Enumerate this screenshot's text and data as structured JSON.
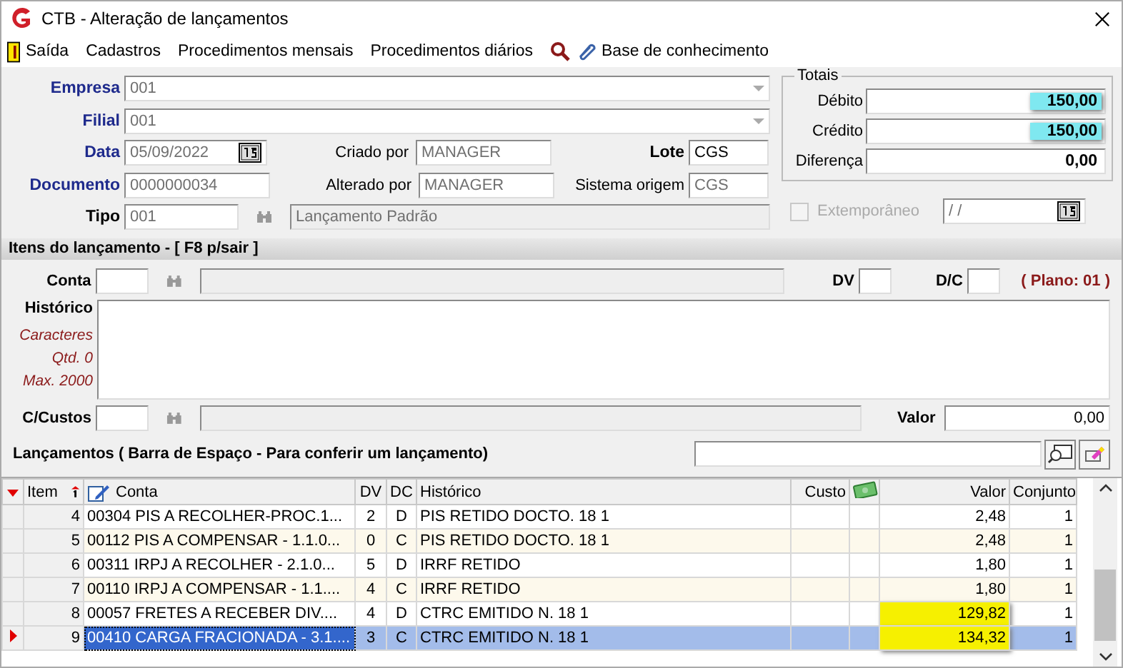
{
  "window": {
    "title": "CTB - Alteração de lançamentos"
  },
  "menu": [
    {
      "label": "Saída",
      "kind": "exit"
    },
    {
      "label": "Cadastros",
      "kind": "text"
    },
    {
      "label": "Procedimentos mensais",
      "kind": "text"
    },
    {
      "label": "Procedimentos diários",
      "kind": "text"
    },
    {
      "kind": "search"
    },
    {
      "label": "Base de conhecimento",
      "kind": "link"
    }
  ],
  "header": {
    "empresa": {
      "label": "Empresa",
      "value": "001"
    },
    "filial": {
      "label": "Filial",
      "value": "001"
    },
    "data": {
      "label": "Data",
      "value": "05/09/2022"
    },
    "documento": {
      "label": "Documento",
      "value": "0000000034"
    },
    "tipo": {
      "label": "Tipo",
      "value": "001",
      "description": "Lançamento Padrão"
    },
    "criado_por": {
      "label": "Criado por",
      "value": "MANAGER"
    },
    "alterado_por": {
      "label": "Alterado por",
      "value": "MANAGER"
    },
    "lote": {
      "label": "Lote",
      "value": "CGS"
    },
    "sistema_origem": {
      "label": "Sistema origem",
      "value": "CGS"
    }
  },
  "totais": {
    "title": "Totais",
    "rows": [
      {
        "label": "Débito",
        "value": "150,00",
        "highlighted": true
      },
      {
        "label": "Crédito",
        "value": "150,00",
        "highlighted": true
      },
      {
        "label": "Diferença",
        "value": "0,00",
        "highlighted": false
      }
    ]
  },
  "extemporaneo": {
    "label": "Extemporâneo",
    "checked": false,
    "disabled": true,
    "date": "/ /"
  },
  "itens": {
    "title": "Itens do lançamento - [ F8 p/sair ]",
    "conta_label": "Conta",
    "dv_label": "DV",
    "dc_label": "D/C",
    "plano": "( Plano: 01 )",
    "historico_label": "Histórico",
    "char_info": [
      "Caracteres",
      "Qtd. 0",
      "Max. 2000"
    ],
    "ccustos_label": "C/Custos",
    "valor_label": "Valor",
    "valor": "0,00"
  },
  "lancamentos": {
    "title": "Lançamentos ( Barra de Espaço - Para conferir um lançamento)",
    "columns": [
      "Item",
      "Conta",
      "DV",
      "DC",
      "Histórico",
      "Custo",
      "",
      "Valor",
      "Conjunto"
    ],
    "rows": [
      {
        "item": "4",
        "conta": "00304 PIS A RECOLHER-PROC.1...",
        "dv": "2",
        "dc": "D",
        "historico": "PIS RETIDO DOCTO. 18 1",
        "valor": "2,48",
        "conjunto": "1",
        "selected": false,
        "highlighted": false
      },
      {
        "item": "5",
        "conta": "00112 PIS A COMPENSAR - 1.1.0...",
        "dv": "0",
        "dc": "C",
        "historico": "PIS RETIDO DOCTO. 18 1",
        "valor": "2,48",
        "conjunto": "1",
        "selected": false,
        "highlighted": false
      },
      {
        "item": "6",
        "conta": "00311 IRPJ A RECOLHER - 2.1.0...",
        "dv": "5",
        "dc": "D",
        "historico": "IRRF RETIDO",
        "valor": "1,80",
        "conjunto": "1",
        "selected": false,
        "highlighted": false
      },
      {
        "item": "7",
        "conta": "00110 IRPJ A COMPENSAR - 1.1....",
        "dv": "4",
        "dc": "C",
        "historico": "IRRF RETIDO",
        "valor": "1,80",
        "conjunto": "1",
        "selected": false,
        "highlighted": false
      },
      {
        "item": "8",
        "conta": "00057 FRETES A RECEBER DIV....",
        "dv": "4",
        "dc": "D",
        "historico": "CTRC EMITIDO N. 18 1",
        "valor": "129,82",
        "conjunto": "1",
        "selected": false,
        "highlighted": true
      },
      {
        "item": "9",
        "conta": "00410 CARGA FRACIONADA - 3.1....",
        "dv": "3",
        "dc": "C",
        "historico": "CTRC EMITIDO N. 18 1",
        "valor": "134,32",
        "conjunto": "1",
        "selected": true,
        "highlighted": true
      }
    ]
  }
}
